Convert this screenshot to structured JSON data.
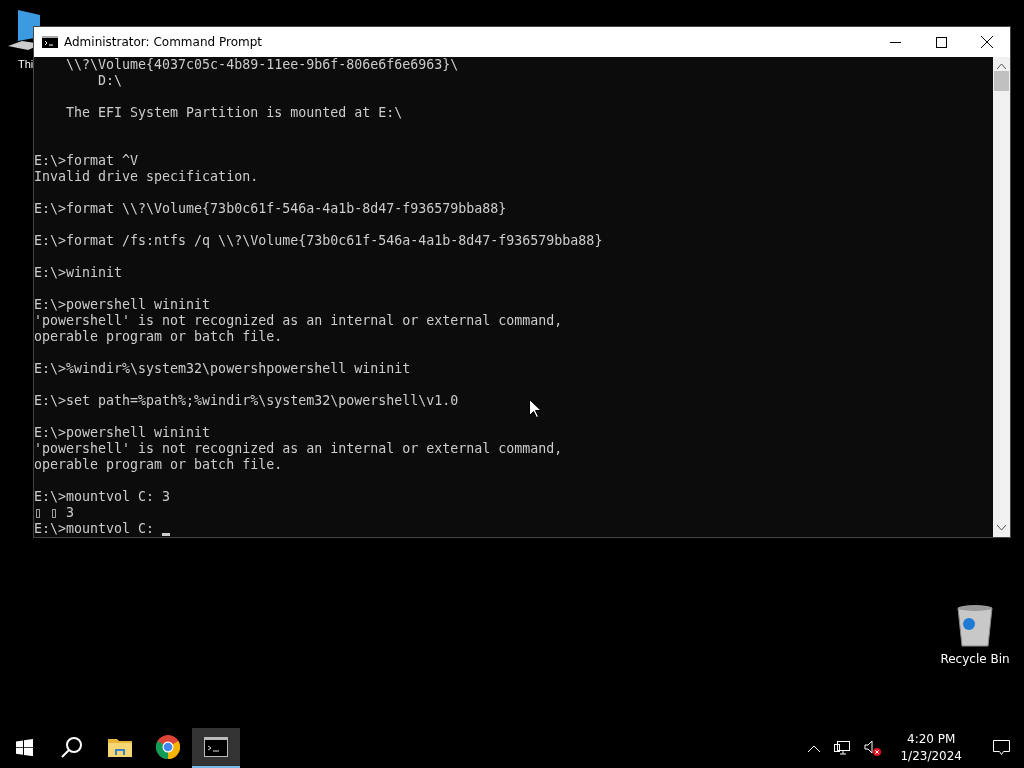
{
  "desktop_icons": [
    {
      "label": "Thi",
      "kind": "pc"
    },
    {
      "label": "Recycle Bin",
      "kind": "bin"
    }
  ],
  "window": {
    "title": "Administrator: Command Prompt",
    "active": true
  },
  "console_lines": [
    {
      "kind": "text",
      "text": "    \\\\?\\Volume{4037c05c-4b89-11ee-9b6f-806e6f6e6963}\\"
    },
    {
      "kind": "text",
      "text": "        D:\\"
    },
    {
      "kind": "blank"
    },
    {
      "kind": "text",
      "text": "    The EFI System Partition is mounted at E:\\"
    },
    {
      "kind": "blank"
    },
    {
      "kind": "blank"
    },
    {
      "kind": "text",
      "text": "E:\\>format ^V"
    },
    {
      "kind": "text",
      "text": "Invalid drive specification."
    },
    {
      "kind": "blank"
    },
    {
      "kind": "text",
      "text": "E:\\>format \\\\?\\Volume{73b0c61f-546a-4a1b-8d47-f936579bba88}"
    },
    {
      "kind": "blank"
    },
    {
      "kind": "text",
      "text": "E:\\>format /fs:ntfs /q \\\\?\\Volume{73b0c61f-546a-4a1b-8d47-f936579bba88}"
    },
    {
      "kind": "blank"
    },
    {
      "kind": "text",
      "text": "E:\\>wininit"
    },
    {
      "kind": "blank"
    },
    {
      "kind": "text",
      "text": "E:\\>powershell wininit"
    },
    {
      "kind": "text",
      "text": "'powershell' is not recognized as an internal or external command,"
    },
    {
      "kind": "text",
      "text": "operable program or batch file."
    },
    {
      "kind": "blank"
    },
    {
      "kind": "text",
      "text": "E:\\>%windir%\\system32\\powershpowershell wininit"
    },
    {
      "kind": "blank"
    },
    {
      "kind": "text",
      "text": "E:\\>set path=%path%;%windir%\\system32\\powershell\\v1.0"
    },
    {
      "kind": "blank"
    },
    {
      "kind": "text",
      "text": "E:\\>powershell wininit"
    },
    {
      "kind": "text",
      "text": "'powershell' is not recognized as an internal or external command,"
    },
    {
      "kind": "text",
      "text": "operable program or batch file."
    },
    {
      "kind": "blank"
    },
    {
      "kind": "text",
      "text": "E:\\>mountvol C: 3"
    },
    {
      "kind": "text",
      "text": "▯ ▯ 3"
    },
    {
      "kind": "prompt",
      "text": "E:\\>mountvol C:"
    }
  ],
  "taskbar": {
    "apps": [
      {
        "kind": "start",
        "selected": false
      },
      {
        "kind": "search",
        "selected": false
      },
      {
        "kind": "folder",
        "selected": false
      },
      {
        "kind": "browser",
        "selected": false
      },
      {
        "kind": "console",
        "selected": true
      }
    ],
    "tray": {
      "volume_muted": true,
      "time": "4:20 PM",
      "date": "1/23/2024"
    }
  }
}
